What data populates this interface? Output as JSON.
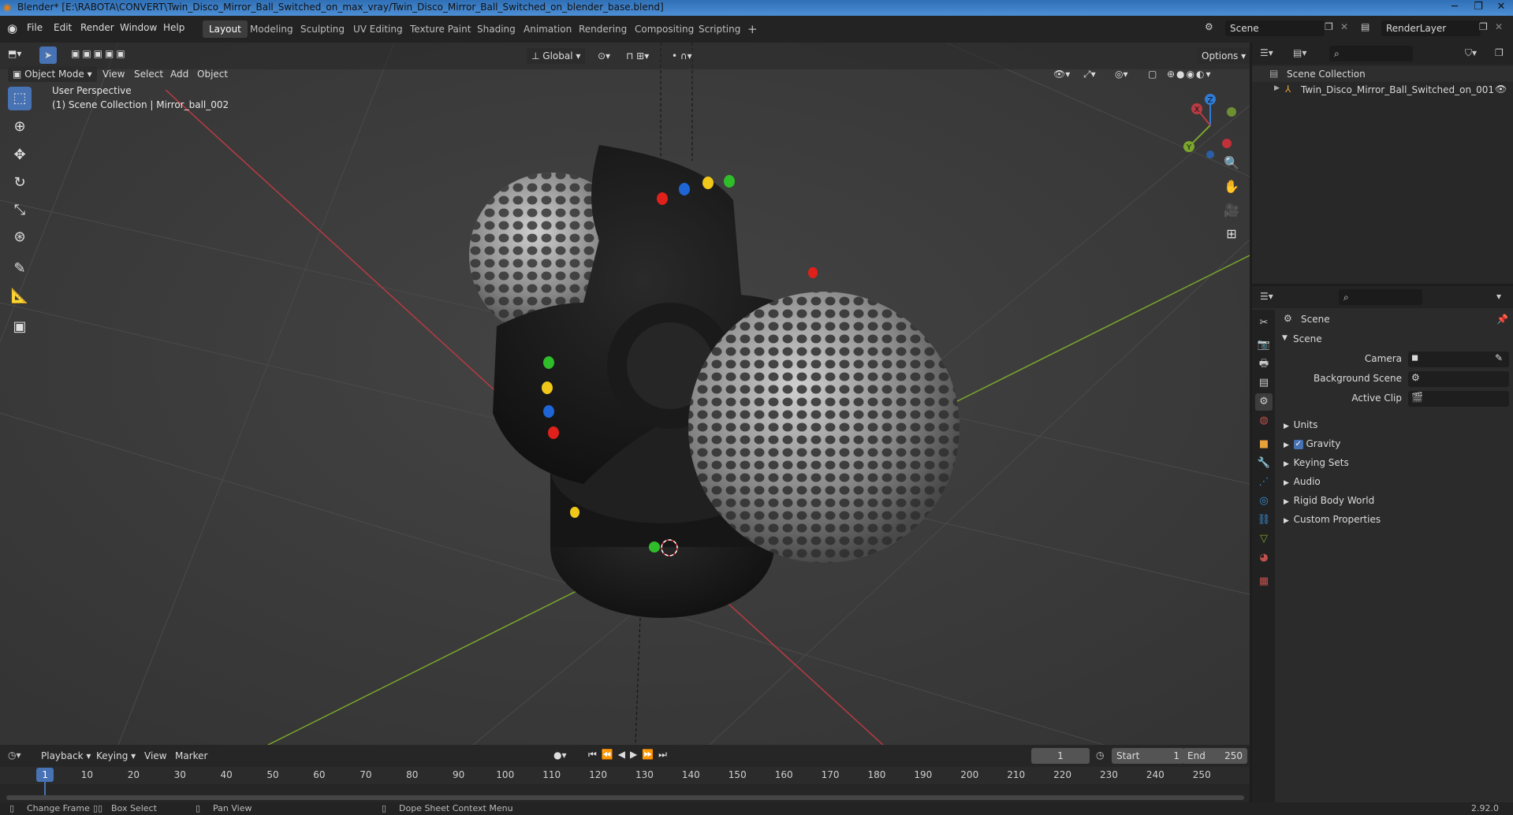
{
  "titlebar": {
    "title": "Blender* [E:\\RABOTA\\CONVERT\\Twin_Disco_Mirror_Ball_Switched_on_max_vray/Twin_Disco_Mirror_Ball_Switched_on_blender_base.blend]"
  },
  "menu": [
    "File",
    "Edit",
    "Render",
    "Window",
    "Help"
  ],
  "workspaces": [
    "Layout",
    "Modeling",
    "Sculpting",
    "UV Editing",
    "Texture Paint",
    "Shading",
    "Animation",
    "Rendering",
    "Compositing",
    "Scripting"
  ],
  "active_workspace": "Layout",
  "scene_field": "Scene",
  "renderlayer_field": "RenderLayer",
  "viewport_header": {
    "mode": "Object Mode",
    "menus": [
      "View",
      "Select",
      "Add",
      "Object"
    ],
    "orientation": "Global",
    "options": "Options"
  },
  "viewport_overlay": {
    "perspective": "User Perspective",
    "collection": "(1) Scene Collection | Mirror_ball_002"
  },
  "gizmo": {
    "x": "X",
    "y": "Y",
    "z": "Z"
  },
  "outliner": {
    "root": "Scene Collection",
    "items": [
      "Twin_Disco_Mirror_Ball_Switched_on_001"
    ]
  },
  "properties": {
    "header": "Scene",
    "panel": "Scene",
    "rows": [
      {
        "label": "Camera"
      },
      {
        "label": "Background Scene"
      },
      {
        "label": "Active Clip"
      }
    ],
    "sections": [
      "Units",
      "Gravity",
      "Keying Sets",
      "Audio",
      "Rigid Body World",
      "Custom Properties"
    ],
    "gravity_checked": true
  },
  "timeline": {
    "menus": [
      "Playback",
      "Keying",
      "View",
      "Marker"
    ],
    "current_frame": "1",
    "start_label": "Start",
    "start": "1",
    "end_label": "End",
    "end": "250",
    "ticks": [
      "1",
      "10",
      "20",
      "30",
      "40",
      "50",
      "60",
      "70",
      "80",
      "90",
      "100",
      "110",
      "120",
      "130",
      "140",
      "150",
      "160",
      "170",
      "180",
      "190",
      "200",
      "210",
      "220",
      "230",
      "240",
      "250"
    ]
  },
  "statusbar": {
    "items": [
      "Change Frame",
      "Box Select",
      "Pan View",
      "Dope Sheet Context Menu"
    ],
    "version": "2.92.0"
  },
  "colors": {
    "accent": "#4772b3",
    "x_axis": "#b83b43",
    "y_axis": "#7ba62b",
    "z_axis": "#2f7cd6"
  }
}
